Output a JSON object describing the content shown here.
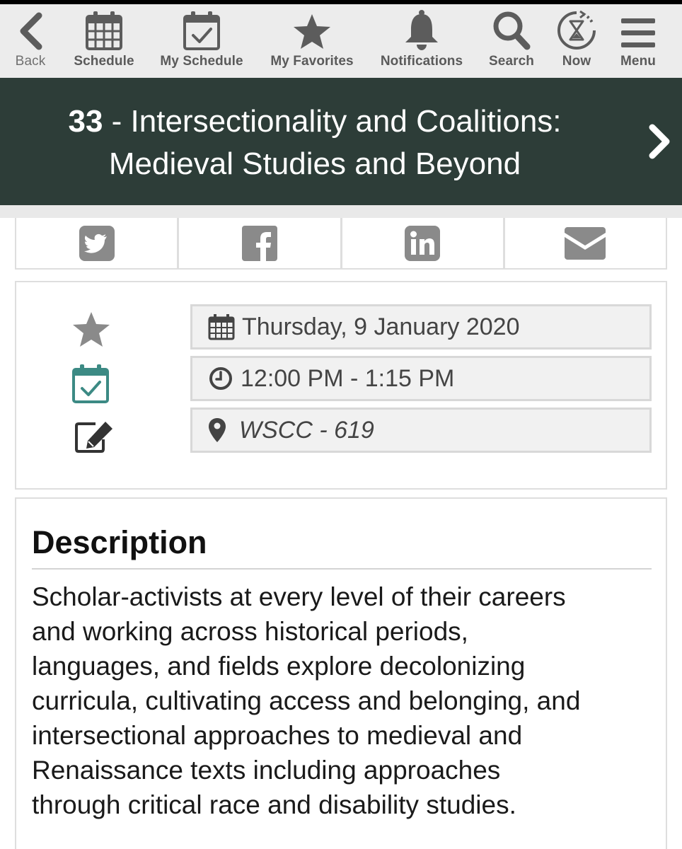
{
  "nav": {
    "back": "Back",
    "schedule": "Schedule",
    "my_schedule": "My Schedule",
    "my_favorites": "My Favorites",
    "notifications": "Notifications",
    "search": "Search",
    "now": "Now",
    "menu": "Menu"
  },
  "session": {
    "number": "33",
    "separator": " - ",
    "title_line1": "Intersectionality and Coalitions:",
    "title_line2": "Medieval Studies and Beyond"
  },
  "share": {
    "icons": [
      "twitter-icon",
      "facebook-icon",
      "linkedin-icon",
      "email-icon"
    ]
  },
  "details": {
    "date": "Thursday, 9 January 2020",
    "time": "12:00 PM - 1:15 PM",
    "location": "WSCC - 619"
  },
  "description": {
    "heading": "Description",
    "lines": [
      "Scholar-activists at every level of their careers",
      "and working across historical periods,",
      "languages, and fields explore decolonizing",
      "curricula, cultivating access and belonging, and",
      "intersectional approaches to medieval and",
      "Renaissance texts including approaches",
      "through critical race and disability studies."
    ]
  },
  "colors": {
    "banner": "#2d3d38",
    "nav_bg": "#ececec",
    "icon_gray": "#5c5c5c",
    "share_gray": "#8a8a8a",
    "calendar_teal": "#3c8a84"
  }
}
